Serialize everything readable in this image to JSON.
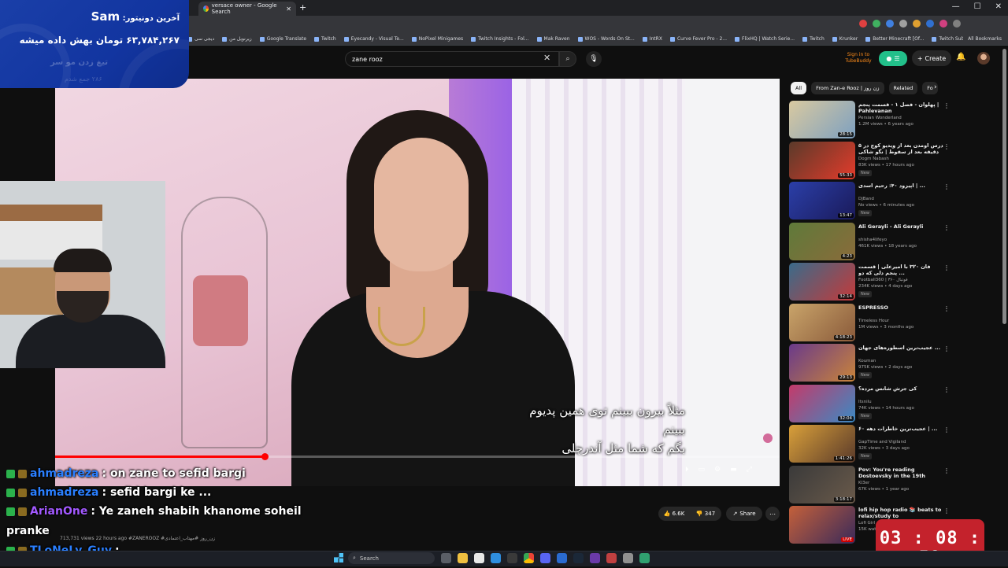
{
  "browser": {
    "active_tab": "versace owner - Google Search",
    "bookmarks": [
      "دیجی سی",
      "زیرنویل من",
      "Google Translate",
      "Twitch",
      "Eyecandy - Visual Te...",
      "NoPixel Minigames",
      "Twitch Insights - Fol...",
      "Mak Raven",
      "WOS - Words On St...",
      "IntRX",
      "Curve Fever Pro - 2...",
      "FlixHQ | Watch Serie...",
      "Twitch",
      "Krunker",
      "Better Minecraft [Of...",
      "Twitch Sub Vod"
    ],
    "all_bookmarks": "All Bookmarks"
  },
  "donation": {
    "title_prefix": "آخرین دونیتور:",
    "name": "Sam",
    "amount": "۶۳,۷۸۴,۲۶۷ تومان بهش داده میشه"
  },
  "youtube": {
    "search_value": "zane rooz",
    "tubebuddy": "Sign in to TubeBuddy",
    "create_label": "Create",
    "faded_channel": "تیغ زدن مو سر",
    "faded_sub": "۲۸۶ جمع شدم",
    "subtitle_line1": "مثلاً بیرون ببینم توی همین پدیوم ببینم",
    "subtitle_line2": "بگم که شما مثل آندرچلی",
    "video_progress": 0.289,
    "views_line": "713,731 views  22 hours ago  #ZANEROOZ #زن_روز #مهتاب_اعتمادی",
    "likes": "6.6K",
    "dislikes": "347",
    "share_label": "Share",
    "chips": [
      "All",
      "From Zan-e Rooz | زن روز",
      "Related",
      "Fo"
    ]
  },
  "recommendations": [
    {
      "title": "پهلوان - فصل ۱ - قسمت پنجم | Pahlevanan",
      "channel": "Persian Wonderland",
      "meta": "1.2M views • 6 years ago",
      "duration": "28:15",
      "new": false,
      "color1": "#d9c9a0",
      "color2": "#7da0c0"
    },
    {
      "title": "درس اومدن بعد از ویدیو کوچ در ۵ دقیقه بعد از سقوط | نگو شاکی 47",
      "channel": "Dogm Nabash",
      "meta": "83K views • 17 hours ago",
      "duration": "55:33",
      "new": true,
      "color1": "#5a3a2a",
      "color2": "#e43b2b"
    },
    {
      "title": "اپیزود ۴۰: رحیم اسدی | ...",
      "channel": "DjBand",
      "meta": "No views • 6 minutes ago",
      "duration": "13:47",
      "new": true,
      "color1": "#2b3fa8",
      "color2": "#1a1a5a"
    },
    {
      "title": "Ali Gerayli - Ali Gerayli",
      "channel": "shisha4lifeyo",
      "meta": "461K views • 18 years ago",
      "duration": "4:23",
      "new": false,
      "color1": "#5f7a3a",
      "color2": "#8a6b3a"
    },
    {
      "title": "فان ۳۲۰ با امیرعلی | قسمت پنجم دلی که دو ...",
      "channel": "Football360 | فوتبال ۳۶۰",
      "meta": "234K views • 4 days ago",
      "duration": "32:14",
      "new": true,
      "color1": "#3a6b8a",
      "color2": "#c43a3a"
    },
    {
      "title": "ESPRESSO",
      "channel": "Timeless Hour",
      "meta": "1M views • 3 months ago",
      "duration": "4:18:23",
      "new": false,
      "color1": "#c9a46a",
      "color2": "#8a5a3a"
    },
    {
      "title": "عجیب‌ترین اسطوره‌های جهان ...",
      "channel": "Kouman",
      "meta": "975K views • 2 days ago",
      "duration": "29:13",
      "new": true,
      "color1": "#6a3a8a",
      "color2": "#c9843a"
    },
    {
      "title": "کی جرش شانس مرده؟",
      "channel": "Itsnilu",
      "meta": "74K views • 14 hours ago",
      "duration": "32:04",
      "new": true,
      "color1": "#c43a6a",
      "color2": "#3a8ac4"
    },
    {
      "title": "عجیب‌ترین خاطرات دهه ۶۰ | ...",
      "channel": "GapTime and Vigiland",
      "meta": "32K views • 3 days ago",
      "duration": "1:41:26",
      "new": true,
      "color1": "#d9a03a",
      "color2": "#5a3a2a"
    },
    {
      "title": "Pov: You're reading Dostoevsky in the 19th century(playlist)",
      "channel": "Kl3er",
      "meta": "67K views • 1 year ago",
      "duration": "3:18:17",
      "new": false,
      "color1": "#3a3a3a",
      "color2": "#6a5a4a"
    },
    {
      "title": "lofi hip hop radio 📚 beats to relax/study to",
      "channel": "Lofi Girl",
      "meta": "15K watching",
      "duration": "LIVE",
      "new": false,
      "color1": "#c4603a",
      "color2": "#3a2a5a"
    }
  ],
  "chat": [
    {
      "user": "ahmadreza",
      "message": ": on zane to sefid bargi",
      "style": "blue"
    },
    {
      "user": "ahmadreza",
      "message": ": sefid bargi ke ...",
      "style": "blue"
    },
    {
      "user": "ArianOne",
      "message": ": Ye zaneh shabih khanome soheil",
      "style": "purple"
    },
    {
      "user": "",
      "message": "pranke",
      "style": "plain"
    },
    {
      "user": "TLoNeLy_Guy",
      "message": ":",
      "style": "blue"
    }
  ],
  "timer": "03 : 08 : 59",
  "taskbar": {
    "search_label": "Search"
  }
}
